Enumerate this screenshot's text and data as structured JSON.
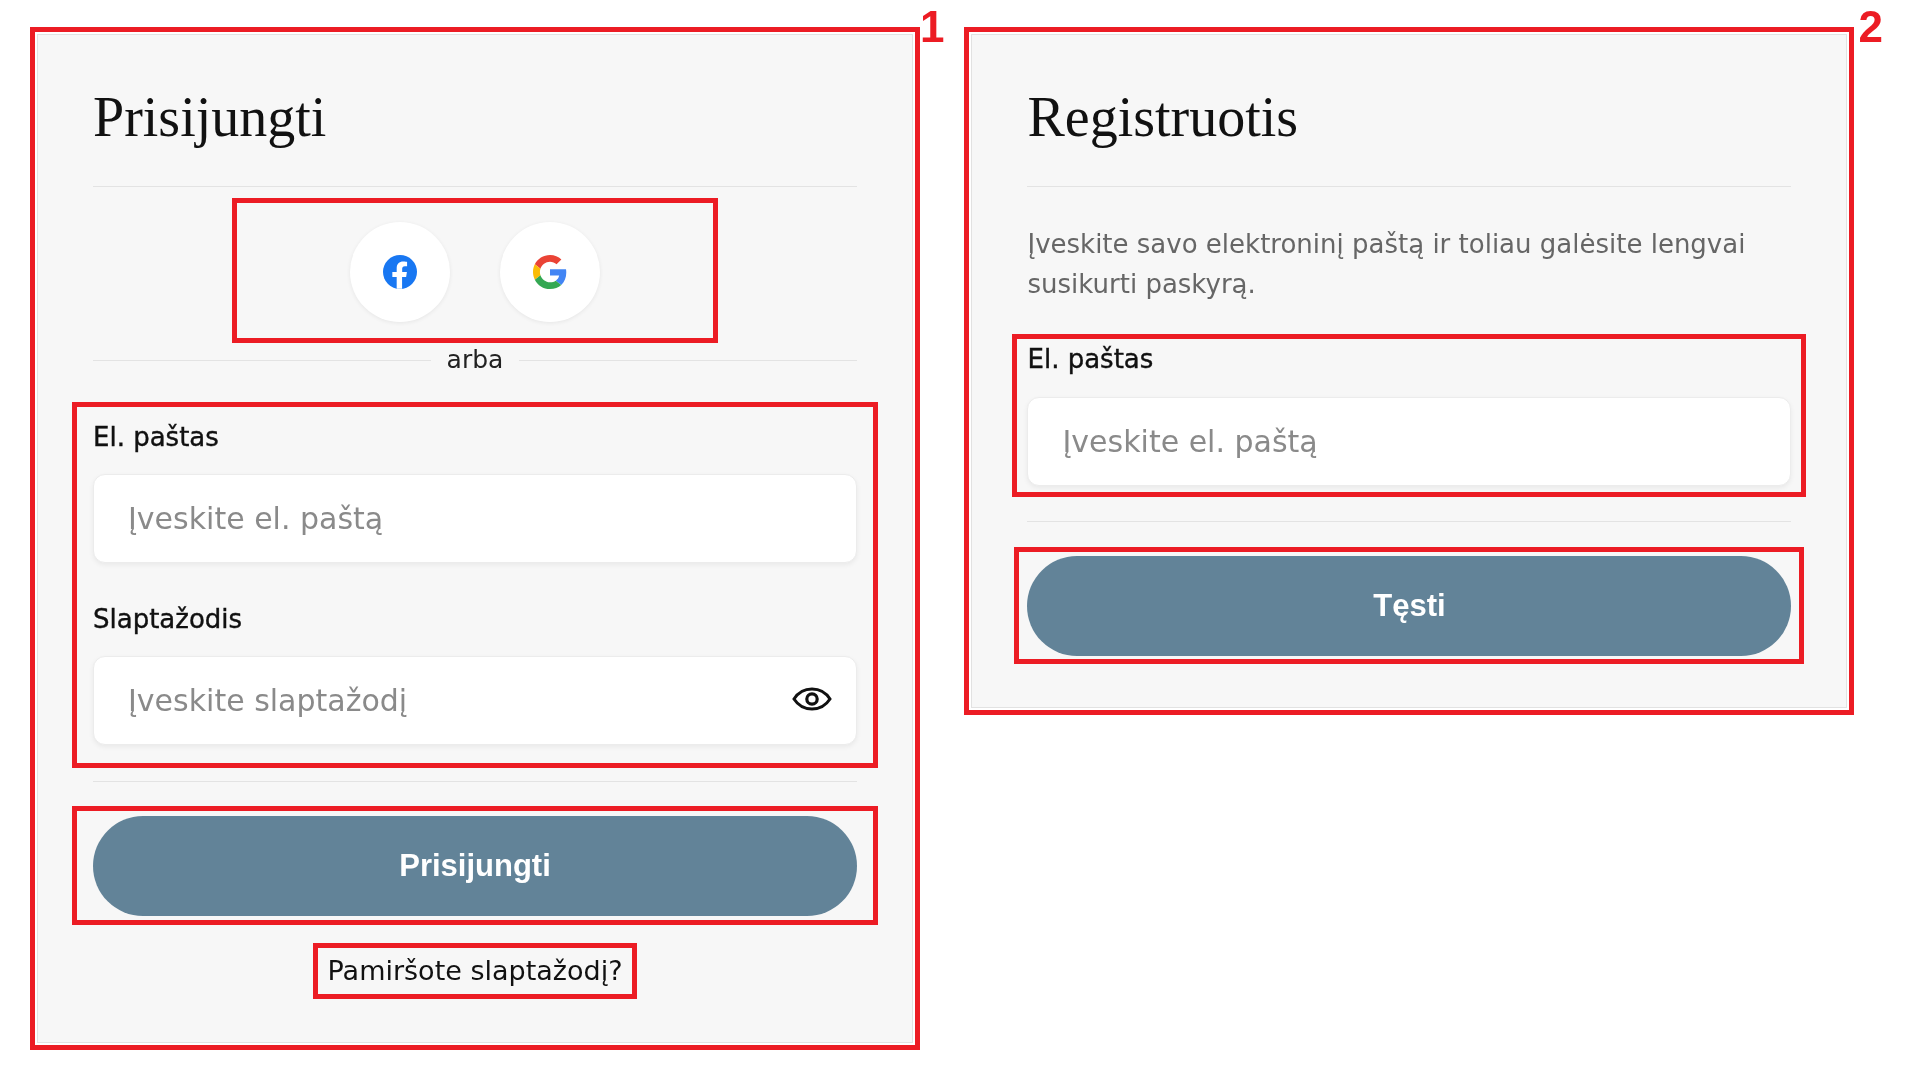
{
  "login_panel": {
    "highlighted": true,
    "marker": "1",
    "title": "Prisijungti",
    "social_buttons": {
      "highlighted": true
    },
    "separator": "arba",
    "fields": {
      "highlighted": true,
      "items": [
        {
          "kind": "email",
          "label": "El. paštas",
          "placeholder": "Įveskite el. paštą"
        },
        {
          "kind": "password",
          "label": "Slaptažodis",
          "placeholder": "Įveskite slaptažodį"
        }
      ]
    },
    "submit_button": {
      "label": "Prisijungti",
      "highlighted": true
    },
    "forgot_link": {
      "label": "Pamiršote slaptažodį?",
      "highlighted": true
    }
  },
  "register_panel": {
    "highlighted": true,
    "marker": "2",
    "title": "Registruotis",
    "description": "Įveskite savo elektroninį paštą ir toliau galėsite lengvai susikurti paskyrą.",
    "fields": {
      "highlighted": true,
      "items": [
        {
          "kind": "email",
          "label": "El. paštas",
          "placeholder": "Įveskite el. paštą"
        }
      ]
    },
    "submit_button": {
      "label": "Tęsti",
      "highlighted": true
    }
  }
}
